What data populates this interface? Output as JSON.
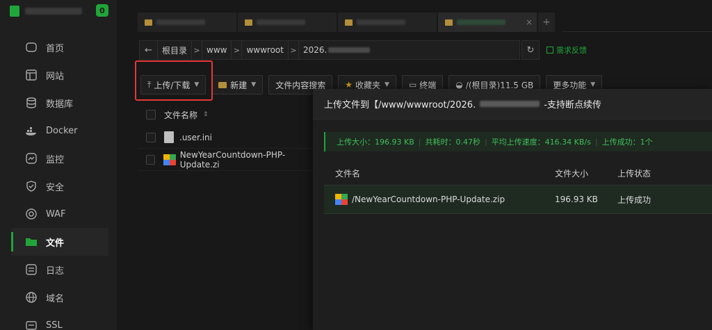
{
  "sidebar": {
    "badge": "0",
    "items": [
      {
        "label": "首页",
        "icon": "home-icon"
      },
      {
        "label": "网站",
        "icon": "website-icon"
      },
      {
        "label": "数据库",
        "icon": "database-icon"
      },
      {
        "label": "Docker",
        "icon": "docker-icon"
      },
      {
        "label": "监控",
        "icon": "monitor-icon"
      },
      {
        "label": "安全",
        "icon": "shield-icon"
      },
      {
        "label": "WAF",
        "icon": "waf-icon"
      },
      {
        "label": "文件",
        "icon": "folder-icon",
        "active": true
      },
      {
        "label": "日志",
        "icon": "log-icon"
      },
      {
        "label": "域名",
        "icon": "globe-icon"
      },
      {
        "label": "SSL",
        "icon": "ssl-icon"
      }
    ]
  },
  "tabs": {
    "add_label": "+",
    "close_label": "×"
  },
  "path": {
    "back": "←",
    "crumbs": [
      "根目录",
      "www",
      "wwwroot",
      "2026."
    ],
    "sep": ">",
    "refresh": "↻",
    "feedback": "需求反馈"
  },
  "toolbar": {
    "upload": "上传/下载",
    "new": "新建",
    "search_content": "文件内容搜索",
    "favorites": "收藏夹",
    "terminal": "终端",
    "disk": "/(根目录)11.5 GB",
    "more": "更多功能"
  },
  "filelist": {
    "header_name": "文件名称",
    "sort_icon": "⇕",
    "rows": [
      {
        "name": ".user.ini",
        "type": "doc"
      },
      {
        "name": "NewYearCountdown-PHP-Update.zi",
        "type": "zip"
      }
    ]
  },
  "dialog": {
    "title_prefix": "上传文件到【/www/wwwroot/2026.",
    "title_suffix": "-支持断点续传",
    "summary": {
      "size": "上传大小：196.93 KB",
      "time": "共耗时：0.47秒",
      "speed": "平均上传速度：416.34 KB/s",
      "success": "上传成功：1个",
      "sep": "|"
    },
    "columns": {
      "name": "文件名",
      "size": "文件大小",
      "status": "上传状态"
    },
    "rows": [
      {
        "name": "/NewYearCountdown-PHP-Update.zip",
        "size": "196.93 KB",
        "status": "上传成功"
      }
    ]
  },
  "colors": {
    "accent": "#20a53a",
    "highlight": "#e53935"
  }
}
